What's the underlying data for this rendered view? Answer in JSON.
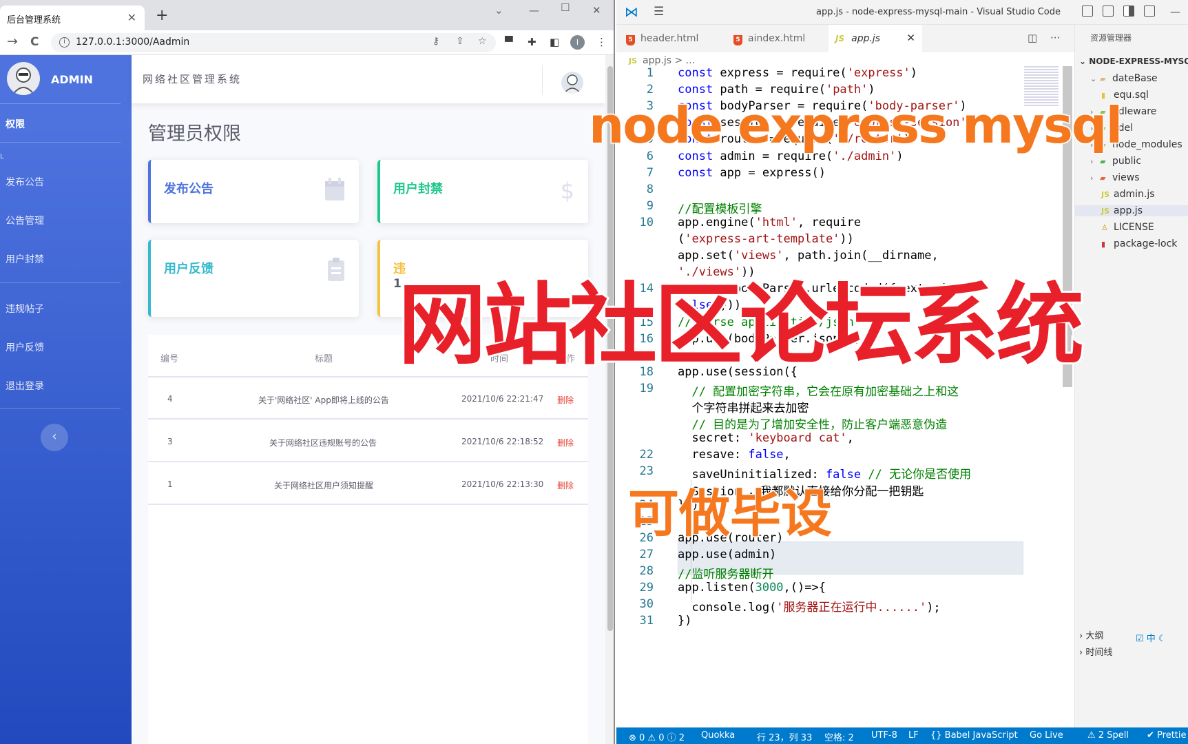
{
  "browser": {
    "tab_title": "后台管理系统",
    "tab_close": "✕",
    "new_tab": "+",
    "url": "127.0.0.1:3000/Aadmin",
    "profile_initial": "I",
    "nav": {
      "back": "→",
      "reload": "C"
    }
  },
  "admin": {
    "brand": "ADMIN",
    "header_title": "网络社区管理系统",
    "page_heading": "管理员权限",
    "sidebar": {
      "section": "权限",
      "dot": "L",
      "items": [
        "发布公告",
        "公告管理",
        "用户封禁",
        "违规帖子",
        "用户反馈",
        "退出登录"
      ],
      "collapse": "‹"
    },
    "cards": [
      {
        "label": "发布公告",
        "color": "#4e73df",
        "icon": "calendar-icon"
      },
      {
        "label": "用户封禁",
        "color": "#1cc88a",
        "icon": "dollar-icon",
        "glyph": "$"
      },
      {
        "label": "用户反馈",
        "color": "#36b9cc",
        "icon": "clipboard-icon"
      },
      {
        "label": "违",
        "value": "1",
        "color": "#f6c23e"
      }
    ],
    "table": {
      "headers": [
        "编号",
        "标题",
        "时间",
        "操作"
      ],
      "rows": [
        {
          "id": "4",
          "title": "关于'网络社区' App即将上线的公告",
          "time": "2021/10/6 22:21:47",
          "action": "删除"
        },
        {
          "id": "3",
          "title": "关于网络社区违规账号的公告",
          "time": "2021/10/6 22:18:52",
          "action": "删除"
        },
        {
          "id": "1",
          "title": "关于网络社区用户须知提醒",
          "time": "2021/10/6 22:13:30",
          "action": "删除"
        }
      ]
    }
  },
  "vscode": {
    "title": "app.js - node-express-mysql-main - Visual Studio Code",
    "tabs": [
      {
        "label": "header.html",
        "type": "html"
      },
      {
        "label": "aindex.html",
        "type": "html"
      },
      {
        "label": "app.js",
        "type": "js",
        "active": true
      }
    ],
    "breadcrumb": "app.js > ...",
    "explorer": {
      "header": "资源管理器",
      "root": "NODE-EXPRESS-MYSQ",
      "items": [
        {
          "label": "dateBase",
          "kind": "folder-open"
        },
        {
          "label": "equ.sql",
          "kind": "file-sql"
        },
        {
          "label": "ddleware",
          "kind": "folder"
        },
        {
          "label": "odel",
          "kind": "folder"
        },
        {
          "label": "node_modules",
          "kind": "folder"
        },
        {
          "label": "public",
          "kind": "folder"
        },
        {
          "label": "views",
          "kind": "folder"
        },
        {
          "label": "admin.js",
          "kind": "file-js"
        },
        {
          "label": "app.js",
          "kind": "file-js",
          "selected": true
        },
        {
          "label": "LICENSE",
          "kind": "file"
        },
        {
          "label": "package-lock",
          "kind": "file"
        }
      ],
      "outline": "大纲",
      "timeline": "时间线"
    },
    "status": {
      "problems": "⊗ 0 ⚠ 0 ⓘ 2",
      "quokka": "Quokka",
      "position": "行 23，列 33",
      "spaces": "空格: 2",
      "encoding": "UTF-8",
      "eol": "LF",
      "language": "{} Babel JavaScript",
      "golive": "Go Live",
      "spell": "⚠ 2 Spell",
      "prettier": "✔ Prettie"
    },
    "line_numbers": [
      "1",
      "2",
      "3",
      "4",
      "5",
      "6",
      "7",
      "8",
      "9",
      "10",
      "",
      "",
      "",
      "14",
      "",
      "15",
      "16",
      "17",
      "18",
      "19",
      "",
      "",
      "",
      "22",
      "23",
      "",
      "24",
      "25",
      "26",
      "27",
      "28",
      "29",
      "30",
      "31"
    ],
    "code_lines": [
      "const express = require('express')",
      "const path = require('path')",
      "const bodyParser = require('body-parser')",
      "const session = require('express-session')",
      "const router =require('./router')",
      "const admin = require('./admin')",
      "const app = express()",
      "",
      "//配置模板引擎",
      "app.engine('html', require",
      "('express-art-template'))",
      "app.set('views', path.join(__dirname,",
      "'./views'))",
      "app.use(bodyParser.urlencoded({ extended:",
      "false }))",
      "// parse application/json",
      "app.use(bodyParser.json())",
      "",
      "app.use(session({",
      "  // 配置加密字符串，它会在原有加密基础之上和这",
      "  个字符串拼起来去加密",
      "  // 目的是为了增加安全性，防止客户端恶意伪造",
      "  secret: 'keyboard cat',",
      "  resave: false,",
      "  saveUninitialized: false // 无论你是否使用",
      "  Session ，我都默认直接给你分配一把钥匙",
      "}))",
      "",
      "app.use(router)",
      "app.use(admin)",
      "//监听服务器断开",
      "app.listen(3000,()=>{",
      "  console.log('服务器正在运行中......');",
      "})"
    ]
  },
  "overlay": {
    "line1": "node express mysql",
    "line2": "网站社区论坛系统",
    "line3": "可做毕设"
  }
}
